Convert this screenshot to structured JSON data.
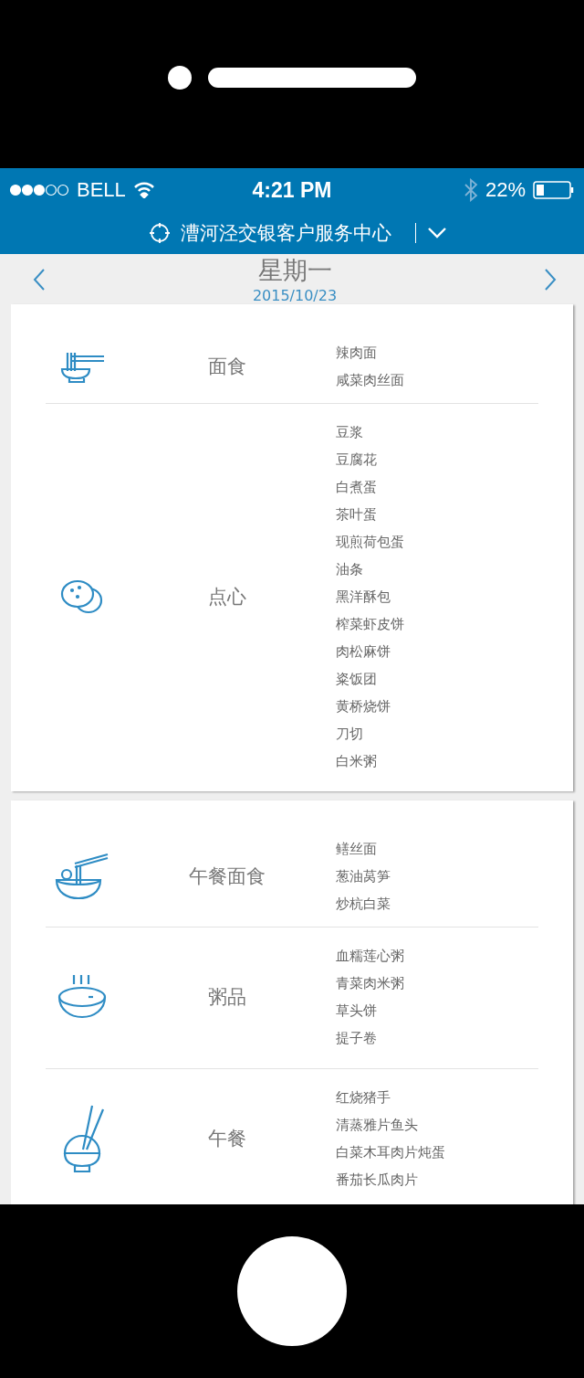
{
  "status_bar": {
    "carrier": "BELL",
    "time": "4:21 PM",
    "battery": "22%"
  },
  "header": {
    "title": "漕河泾交银客户服务中心"
  },
  "day": {
    "weekday": "星期一",
    "date": "2015/10/23"
  },
  "cards": [
    {
      "sections": [
        {
          "category": "面食",
          "dishes": [
            "辣肉面",
            "咸菜肉丝面"
          ]
        },
        {
          "category": "点心",
          "dishes": [
            "豆浆",
            "豆腐花",
            "白煮蛋",
            "茶叶蛋",
            "现煎荷包蛋",
            "油条",
            "黑洋酥包",
            "榨菜虾皮饼",
            "肉松麻饼",
            "粢饭团",
            "黄桥烧饼",
            "刀切",
            "白米粥"
          ]
        }
      ]
    },
    {
      "sections": [
        {
          "category": "午餐面食",
          "dishes": [
            "鳝丝面",
            "葱油莴笋",
            "炒杭白菜"
          ]
        },
        {
          "category": "粥品",
          "dishes": [
            "血糯莲心粥",
            "青菜肉米粥",
            "草头饼",
            "提子卷"
          ]
        },
        {
          "category": "午餐",
          "dishes": [
            "红烧猪手",
            "清蒸雅片鱼头",
            "白菜木耳肉片炖蛋",
            "番茄长瓜肉片"
          ]
        }
      ]
    }
  ]
}
